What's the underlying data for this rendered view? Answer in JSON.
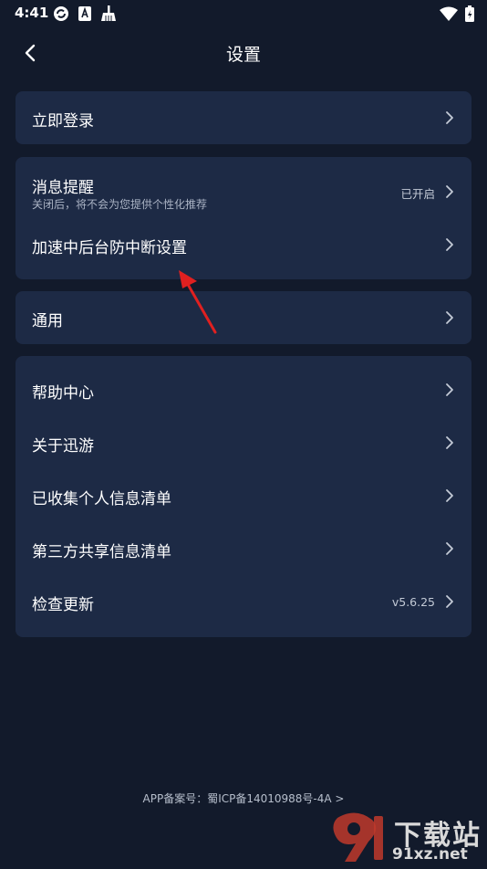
{
  "status_bar": {
    "time": "4:41",
    "left_icons": [
      "sync-icon",
      "accessibility-icon",
      "broom-icon"
    ],
    "right_icons": [
      "wifi-icon",
      "battery-icon"
    ]
  },
  "header": {
    "title": "设置"
  },
  "cards": {
    "login": {
      "label": "立即登录"
    },
    "notifications": {
      "message_label": "消息提醒",
      "message_sub": "关闭后，将不会为您提供个性化推荐",
      "message_value": "已开启",
      "background_label": "加速中后台防中断设置"
    },
    "general": {
      "label": "通用"
    },
    "about": {
      "items": [
        {
          "label": "帮助中心",
          "value": ""
        },
        {
          "label": "关于迅游",
          "value": ""
        },
        {
          "label": "已收集个人信息清单",
          "value": ""
        },
        {
          "label": "第三方共享信息清单",
          "value": ""
        },
        {
          "label": "检查更新",
          "value": "v5.6.25"
        }
      ]
    }
  },
  "footer": {
    "icp_text": "APP备案号：蜀ICP备14010988号-4A  >"
  },
  "watermark": {
    "main": "下载站",
    "sub": "91xz.net"
  },
  "colors": {
    "background": "#121a2b",
    "card": "#1d2a45",
    "annotation_arrow": "#e02020"
  }
}
